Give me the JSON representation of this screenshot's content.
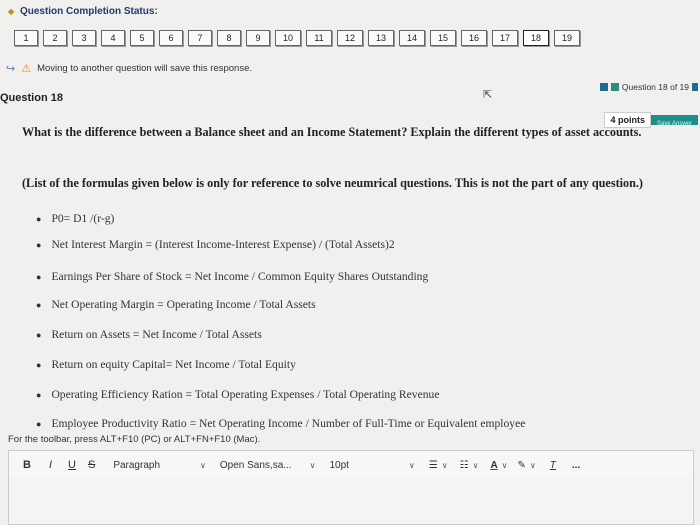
{
  "status": {
    "title": "Question Completion Status:",
    "questions": [
      "1",
      "2",
      "3",
      "4",
      "5",
      "6",
      "7",
      "8",
      "9",
      "10",
      "11",
      "12",
      "13",
      "14",
      "15",
      "16",
      "17",
      "18",
      "19"
    ],
    "warning": "Moving to another question will save this response."
  },
  "progress": {
    "label": "Question 18 of 19"
  },
  "question": {
    "label": "Question 18",
    "points": "4 points",
    "save_label": "Save Answer",
    "text": "What is the difference between a Balance sheet and an Income Statement? Explain the different types of asset accounts.",
    "note": "(List of the formulas given below is only for reference to solve neumrical questions. This is not the part of any question.)"
  },
  "formulas": [
    "P0= D1 /(r-g)",
    "Net Interest Margin = (Interest Income-Interest Expense) / (Total Assets)2",
    "Earnings Per Share of Stock = Net Income / Common Equity Shares Outstanding",
    "Net Operating Margin = Operating Income / Total Assets",
    "Return on Assets = Net Income / Total Assets",
    "Return on equity Capital= Net Income / Total Equity",
    "Operating Efficiency Ration = Total Operating Expenses / Total Operating Revenue",
    "Employee Productivity Ratio = Net Operating Income / Number of Full-Time or Equivalent employee"
  ],
  "toolbar": {
    "hint": "For the toolbar, press ALT+F10 (PC) or ALT+FN+F10 (Mac).",
    "bold": "B",
    "italic": "I",
    "underline": "U",
    "strike": "S",
    "paragraph": "Paragraph",
    "font": "Open Sans,sa...",
    "size": "10pt",
    "more": "..."
  }
}
